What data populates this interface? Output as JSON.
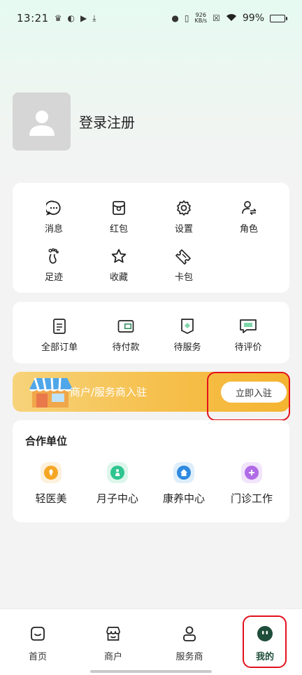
{
  "status_bar": {
    "time": "13:21",
    "net_speed_value": "926",
    "net_speed_unit": "KB/s",
    "battery": "99%"
  },
  "profile": {
    "login_label": "登录注册"
  },
  "menu": {
    "items": [
      {
        "label": "消息",
        "icon": "message-icon"
      },
      {
        "label": "红包",
        "icon": "red-packet-icon"
      },
      {
        "label": "设置",
        "icon": "gear-icon"
      },
      {
        "label": "角色",
        "icon": "switch-role-icon"
      },
      {
        "label": "足迹",
        "icon": "footprint-icon"
      },
      {
        "label": "收藏",
        "icon": "star-icon"
      },
      {
        "label": "卡包",
        "icon": "ticket-icon"
      }
    ]
  },
  "orders": {
    "items": [
      {
        "label": "全部订单",
        "icon": "document-icon"
      },
      {
        "label": "待付款",
        "icon": "wallet-icon"
      },
      {
        "label": "待服务",
        "icon": "service-icon"
      },
      {
        "label": "待评价",
        "icon": "comment-icon"
      }
    ]
  },
  "banner": {
    "text": "商户/服务商入驻",
    "button_label": "立即入驻"
  },
  "partners": {
    "title": "合作单位",
    "items": [
      {
        "label": "轻医美",
        "color": "#f5a623",
        "bg": "#fdf1dc"
      },
      {
        "label": "月子中心",
        "color": "#2ec58e",
        "bg": "#ddf6ec"
      },
      {
        "label": "康养中心",
        "color": "#2f8ae0",
        "bg": "#deeefb"
      },
      {
        "label": "门诊工作",
        "color": "#b06be6",
        "bg": "#f1e4fb"
      }
    ]
  },
  "tabbar": {
    "items": [
      {
        "label": "首页",
        "icon": "home-icon"
      },
      {
        "label": "商户",
        "icon": "shop-icon"
      },
      {
        "label": "服务商",
        "icon": "person-icon"
      },
      {
        "label": "我的",
        "icon": "profile-face-icon"
      }
    ],
    "active_color": "#1f4e3b"
  }
}
